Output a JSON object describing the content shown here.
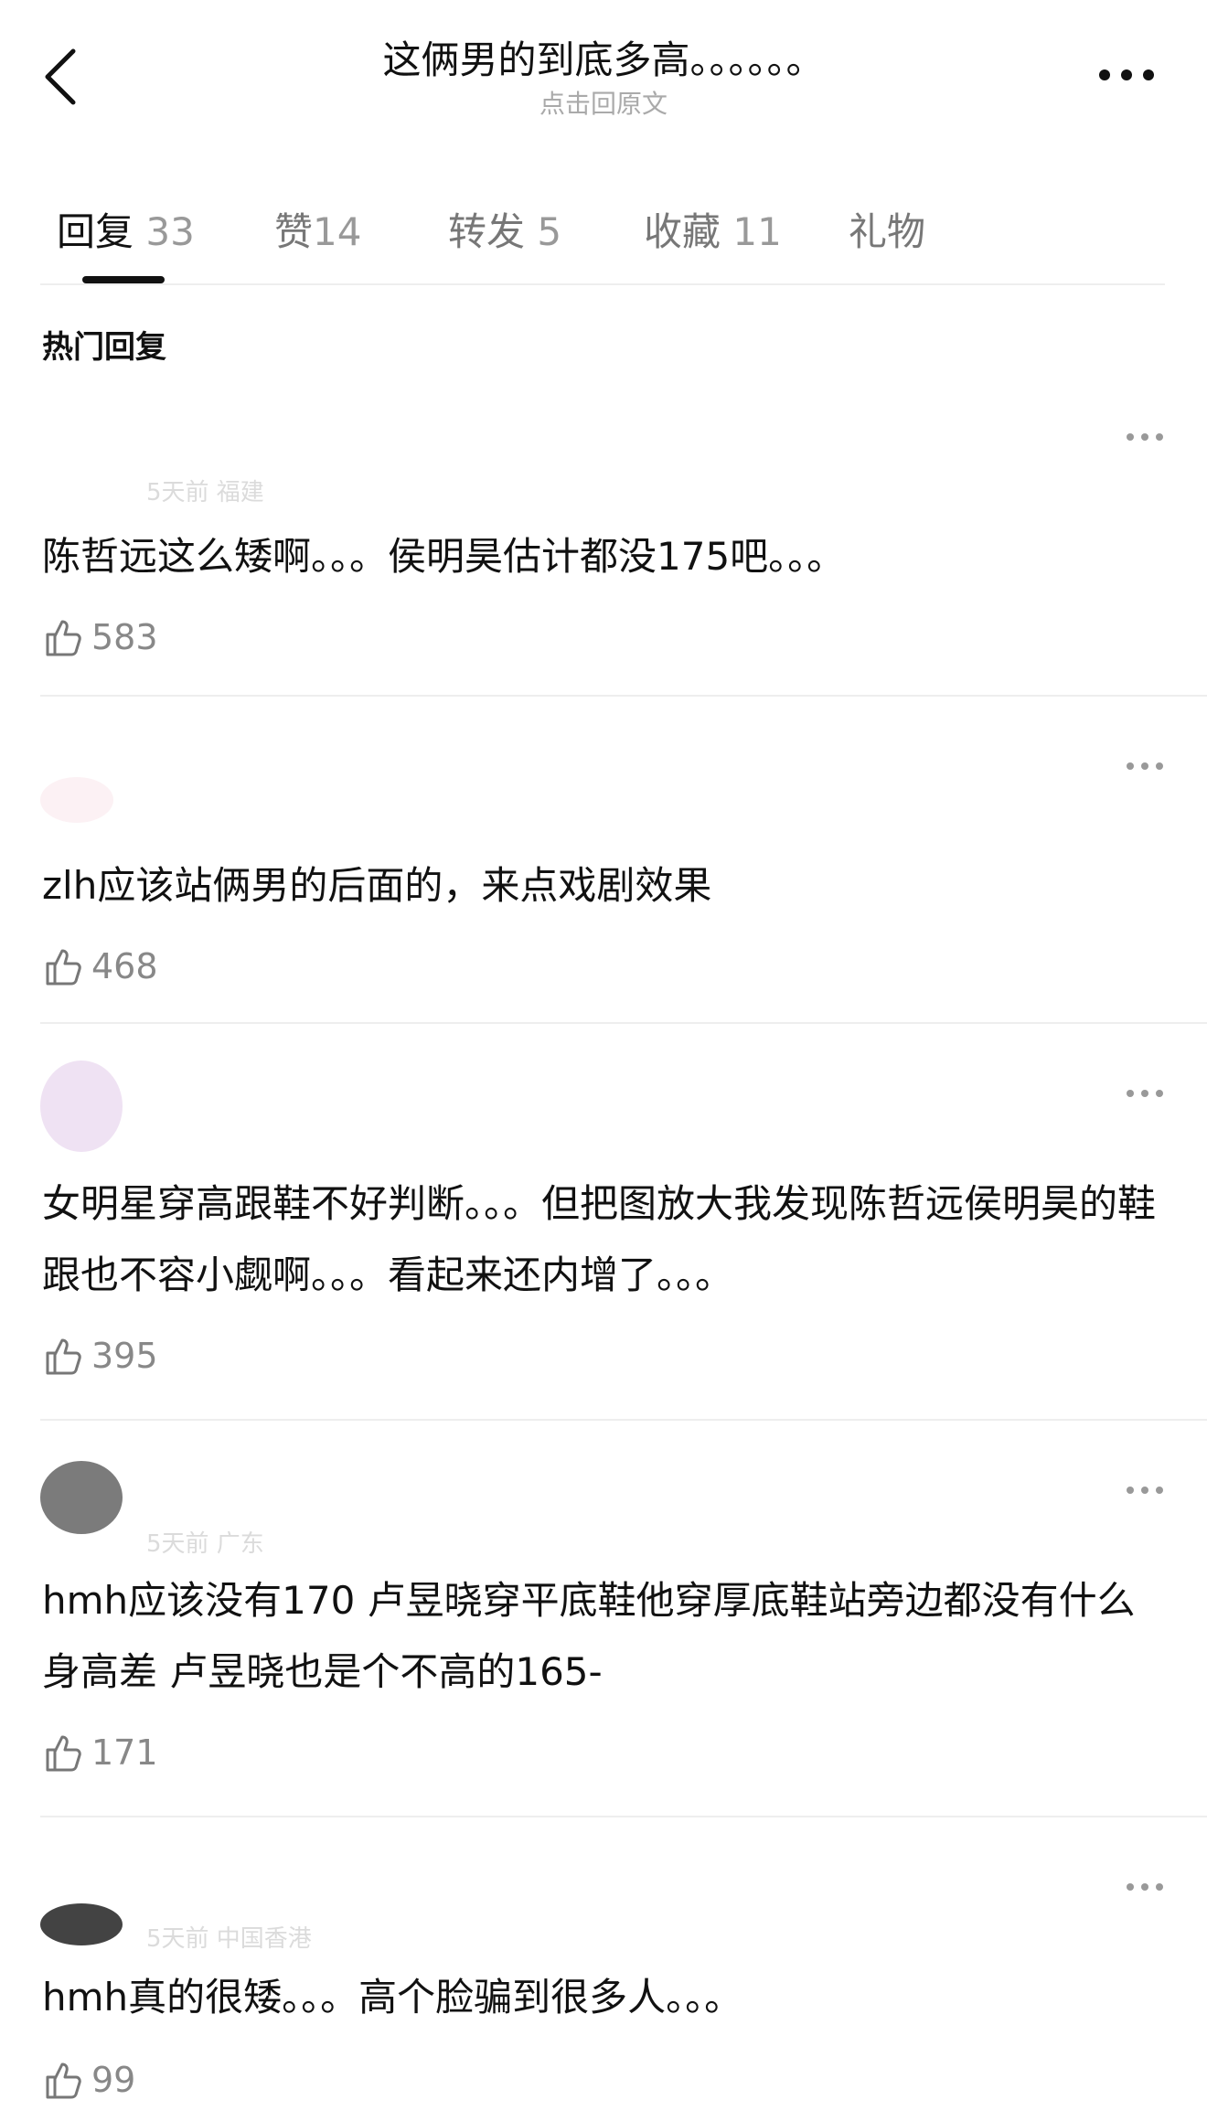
{
  "header": {
    "title": "这俩男的到底多高。。。。。。",
    "subtitle": "点击回原文"
  },
  "tabs": [
    {
      "label": "回复",
      "count": "33"
    },
    {
      "label": "赞",
      "count": "14"
    },
    {
      "label": "转发",
      "count": "5"
    },
    {
      "label": "收藏",
      "count": "11"
    },
    {
      "label": "礼物",
      "count": ""
    }
  ],
  "section_title": "热门回复",
  "comments": [
    {
      "meta": "5天前 福建",
      "text": "陈哲远这么矮啊。。。侯明昊估计都没175吧。。。",
      "likes": "583"
    },
    {
      "meta": "",
      "text": "zlh应该站俩男的后面的，来点戏剧效果",
      "likes": "468"
    },
    {
      "meta": "",
      "text": "女明星穿高跟鞋不好判断。。。但把图放大我发现陈哲远侯明昊的鞋跟也不容小觑啊。。。看起来还内增了。。。",
      "likes": "395"
    },
    {
      "meta": "5天前 广东",
      "text": "hmh应该没有170 卢昱晓穿平底鞋他穿厚底鞋站旁边都没有什么身高差 卢昱晓也是个不高的165-",
      "likes": "171"
    },
    {
      "meta": "5天前 中国香港",
      "text": "hmh真的很矮。。。高个脸骗到很多人。。。",
      "likes": "99"
    }
  ],
  "icons": {
    "back": "chevron-left-icon",
    "more": "more-dots-icon",
    "like": "thumbs-up-icon"
  }
}
